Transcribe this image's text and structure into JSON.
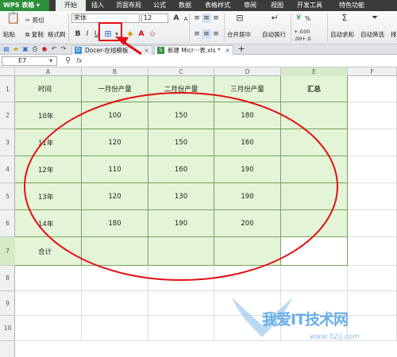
{
  "app": {
    "name": "WPS 表格",
    "brand_color": "#2f8f3a"
  },
  "menu": {
    "tabs": [
      "开始",
      "插入",
      "页面布局",
      "公式",
      "数据",
      "表格样式",
      "审阅",
      "视图",
      "开发工具",
      "特色功能"
    ],
    "active_index": 0
  },
  "ribbon": {
    "paste": "粘贴",
    "cut": "剪切",
    "copy": "复制",
    "format_painter": "格式刷",
    "font_name": "宋体",
    "font_size": "12",
    "bold": "B",
    "italic": "I",
    "underline": "U",
    "merge_center": "合并居中",
    "auto_wrap": "自动换行",
    "percent": "%",
    "autosum": "自动求和",
    "autofilter": "自动筛选",
    "sort": "排",
    "number_format_1": "+.0",
    "number_format_2": ".00",
    "number_format_3": ".00",
    "number_format_4": "+.0"
  },
  "doc_tabs": [
    {
      "label": "Docer-在线模板",
      "active": false
    },
    {
      "label": "新建 Micr···表.xls *",
      "active": true
    }
  ],
  "formula_bar": {
    "cell_ref": "E7",
    "fx": "fx",
    "value": ""
  },
  "grid": {
    "columns": [
      "A",
      "B",
      "C",
      "D",
      "E",
      "F"
    ],
    "rows": [
      "1",
      "2",
      "3",
      "4",
      "5",
      "6",
      "7",
      "8",
      "9",
      "10"
    ],
    "selected_column": "E",
    "table": [
      [
        "时间",
        "一月份产量",
        "二月份产量",
        "三月份产量",
        "汇总"
      ],
      [
        "10年",
        "100",
        "150",
        "180",
        ""
      ],
      [
        "11年",
        "120",
        "150",
        "160",
        ""
      ],
      [
        "12年",
        "110",
        "160",
        "190",
        ""
      ],
      [
        "13年",
        "120",
        "130",
        "190",
        ""
      ],
      [
        "14年",
        "180",
        "190",
        "200",
        ""
      ],
      [
        "合计",
        "",
        "",
        "",
        ""
      ]
    ]
  },
  "annotation": {
    "color": "#e01010"
  },
  "watermark": {
    "text": "我爱IT技术网",
    "url": "www.52ij.com"
  }
}
